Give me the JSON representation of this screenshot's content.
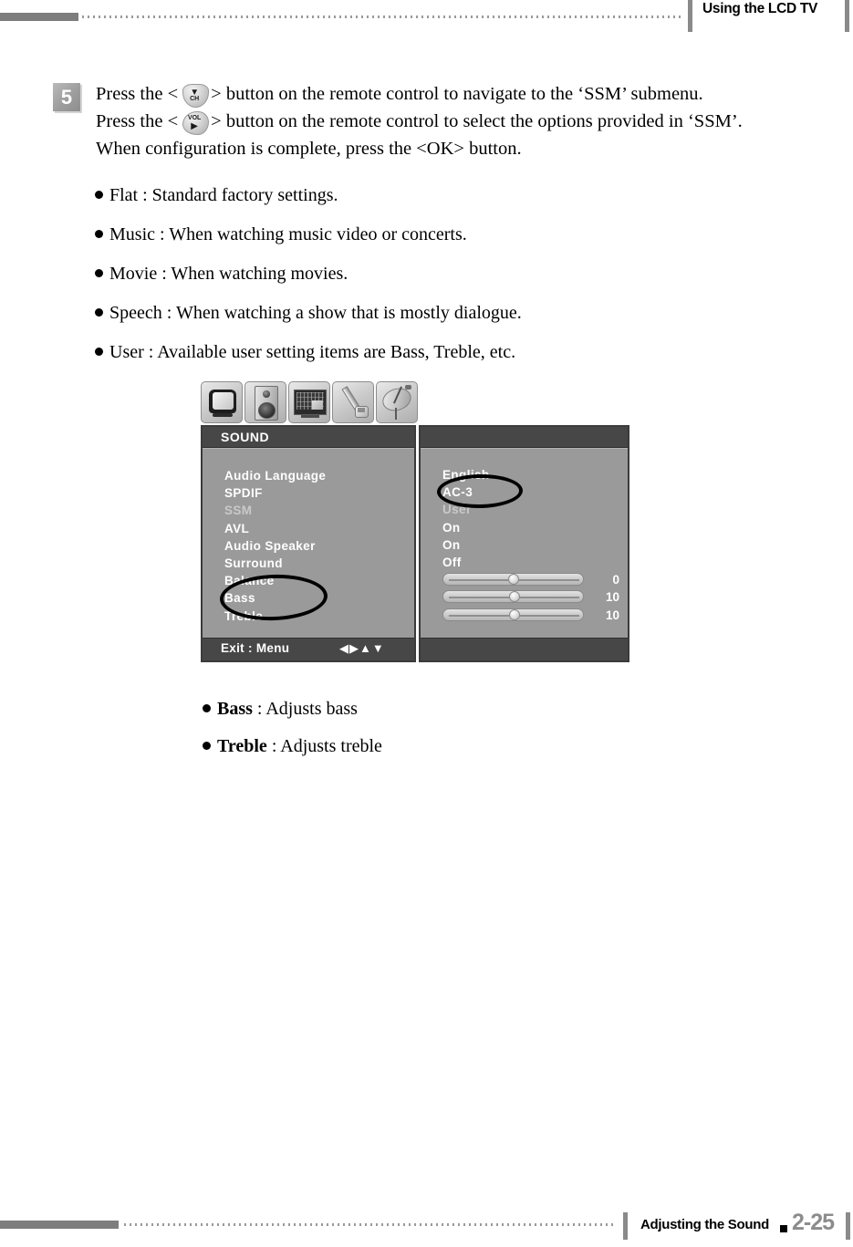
{
  "header": {
    "title": "Using the LCD TV"
  },
  "step": {
    "number": "5",
    "line1_a": "Press the <",
    "line1_icon": "ch-down-button-icon",
    "line1_b": "> button on the remote control to navigate to the ‘SSM’ submenu.",
    "line2_a": "Press the <",
    "line2_icon": "vol-right-button-icon",
    "line2_b": "> button on the remote control to select the options provided in ‘SSM’.",
    "line3": "When configuration is complete, press the <OK> button.",
    "ch_icon_label": "CH",
    "ch_icon_arrow": "▼",
    "vol_icon_label": "VOL",
    "vol_icon_arrow": "▶"
  },
  "ssm_options": [
    "Flat : Standard factory settings.",
    "Music : When watching music video or concerts.",
    "Movie : When watching movies.",
    "Speech : When watching a show that is mostly dialogue.",
    "User : Available user setting items are Bass, Treble, etc."
  ],
  "osd": {
    "icon_tabs": [
      {
        "name": "picture-tv-icon"
      },
      {
        "name": "sound-speaker-icon"
      },
      {
        "name": "feature-screen-icon"
      },
      {
        "name": "setup-wrench-icon"
      },
      {
        "name": "channel-satellite-dish-icon"
      }
    ],
    "title": "SOUND",
    "menu_items": [
      {
        "label": "Audio Language",
        "dim": false
      },
      {
        "label": "SPDIF",
        "dim": false
      },
      {
        "label": "SSM",
        "dim": true
      },
      {
        "label": "AVL",
        "dim": false
      },
      {
        "label": "Audio Speaker",
        "dim": false
      },
      {
        "label": "Surround",
        "dim": false
      },
      {
        "label": "Balance",
        "dim": false
      },
      {
        "label": "Bass",
        "dim": false
      },
      {
        "label": "Treble",
        "dim": false
      }
    ],
    "values": [
      {
        "type": "text",
        "label": "English",
        "dim": false
      },
      {
        "type": "text",
        "label": "AC-3",
        "dim": false
      },
      {
        "type": "text",
        "label": "User",
        "dim": true
      },
      {
        "type": "text",
        "label": "On",
        "dim": false
      },
      {
        "type": "text",
        "label": "On",
        "dim": false
      },
      {
        "type": "text",
        "label": "Off",
        "dim": false
      },
      {
        "type": "slider",
        "value": "0",
        "percent": 50
      },
      {
        "type": "slider",
        "value": "10",
        "percent": 51
      },
      {
        "type": "slider",
        "value": "10",
        "percent": 51
      }
    ],
    "footer": {
      "exit_label": "Exit :   Menu",
      "arrows": "◀▶▲▼"
    },
    "annotations": [
      {
        "name": "bass-treble-circle-annotation"
      },
      {
        "name": "user-circle-annotation"
      }
    ]
  },
  "detail_bullets": [
    {
      "term": "Bass",
      "rest": " : Adjusts bass"
    },
    {
      "term": "Treble",
      "rest": " : Adjusts treble"
    }
  ],
  "footer": {
    "section": "Adjusting the Sound",
    "page_number": "2-25"
  },
  "colors": {
    "rule_gray": "#7d7d7d",
    "osd_panel_bg": "#9a9a9a",
    "osd_titlebar": "#474747",
    "osd_dim_text": "#c9c9c9",
    "page_number_gray": "#8c8c8c"
  }
}
